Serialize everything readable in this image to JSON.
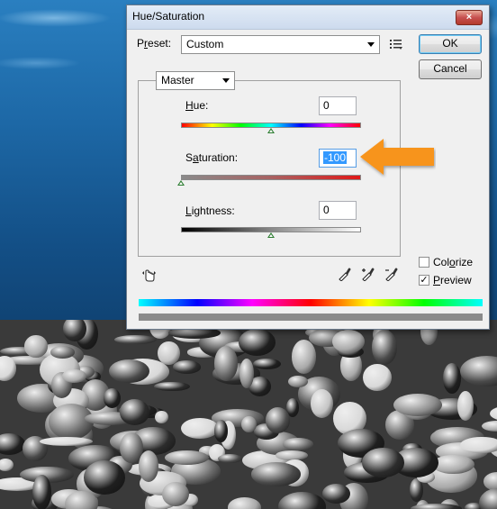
{
  "dialog": {
    "title": "Hue/Saturation",
    "close_icon": "×",
    "preset_label_pre": "P",
    "preset_label_ul": "r",
    "preset_label_post": "eset:",
    "preset_value": "Custom",
    "ok_label": "OK",
    "cancel_label": "Cancel",
    "channel_value": "Master",
    "hue": {
      "label_ul": "H",
      "label_post": "ue:",
      "value": "0",
      "level": 0.5
    },
    "saturation": {
      "label_pre": "S",
      "label_ul": "a",
      "label_post": "turation:",
      "value": "-100",
      "level": 0.0
    },
    "lightness": {
      "label_ul": "L",
      "label_post": "ightness:",
      "value": "0",
      "level": 0.5
    },
    "colorize": {
      "label_pre": "Col",
      "label_ul": "o",
      "label_post": "rize",
      "checked": false
    },
    "preview": {
      "label_ul": "P",
      "label_post": "review",
      "checked": true,
      "check_glyph": "✓"
    }
  },
  "icons": {
    "preset_options": "preset-options-icon",
    "hand_tool": "targeted-adjustment-icon",
    "eyedropper": "eyedropper-icon",
    "eyedropper_plus": "eyedropper-add-icon",
    "eyedropper_minus": "eyedropper-subtract-icon",
    "arrow": "orange-arrow-icon"
  },
  "colors": {
    "accent_arrow": "#f7941d",
    "selection": "#3399ff"
  }
}
